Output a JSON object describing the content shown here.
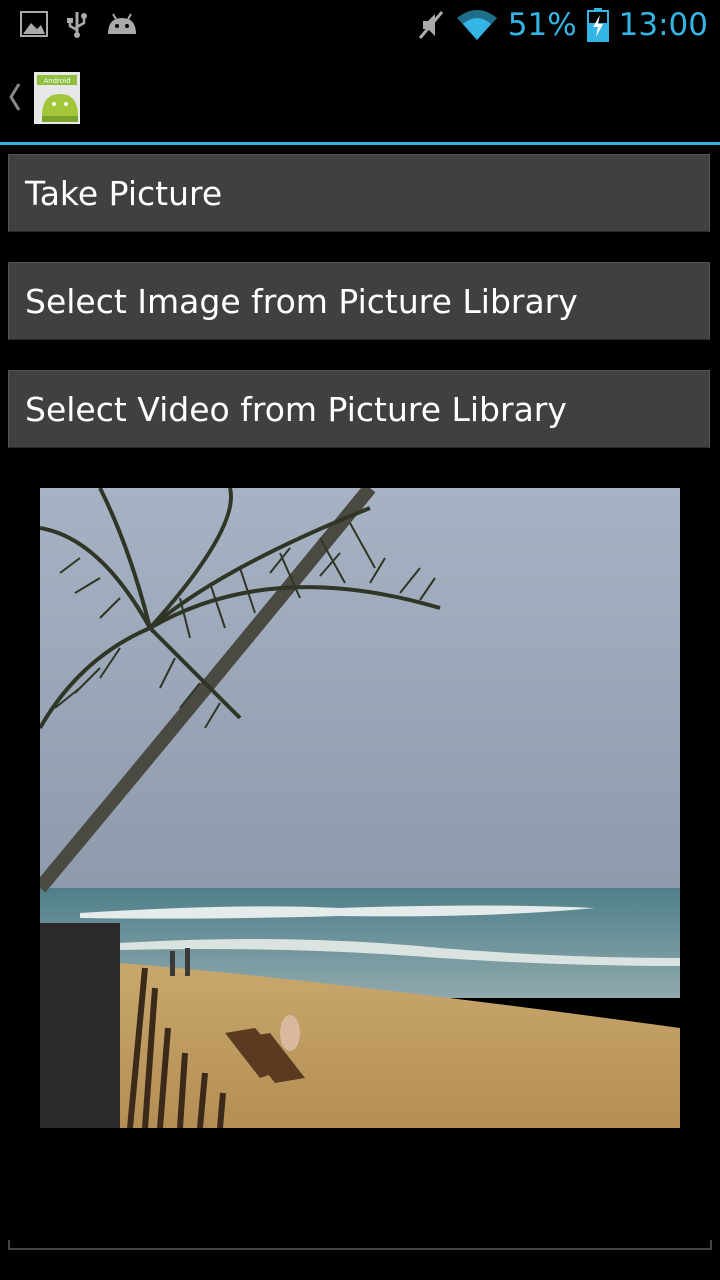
{
  "status_bar": {
    "icons_left": [
      "gallery-icon",
      "usb-icon",
      "android-debug-icon"
    ],
    "icons_right": [
      "mute-icon",
      "wifi-icon",
      "battery-charging-icon"
    ],
    "battery_percent": "51%",
    "time": "13:00",
    "accent_color": "#33b5e5"
  },
  "action_bar": {
    "up_icon": "chevron-left-icon",
    "app_icon": "android-app-icon",
    "app_icon_label": "Android"
  },
  "buttons": {
    "take_picture": "Take Picture",
    "select_image": "Select Image from Picture Library",
    "select_video": "Select Video from Picture Library"
  },
  "preview": {
    "content": "beach-photo"
  }
}
